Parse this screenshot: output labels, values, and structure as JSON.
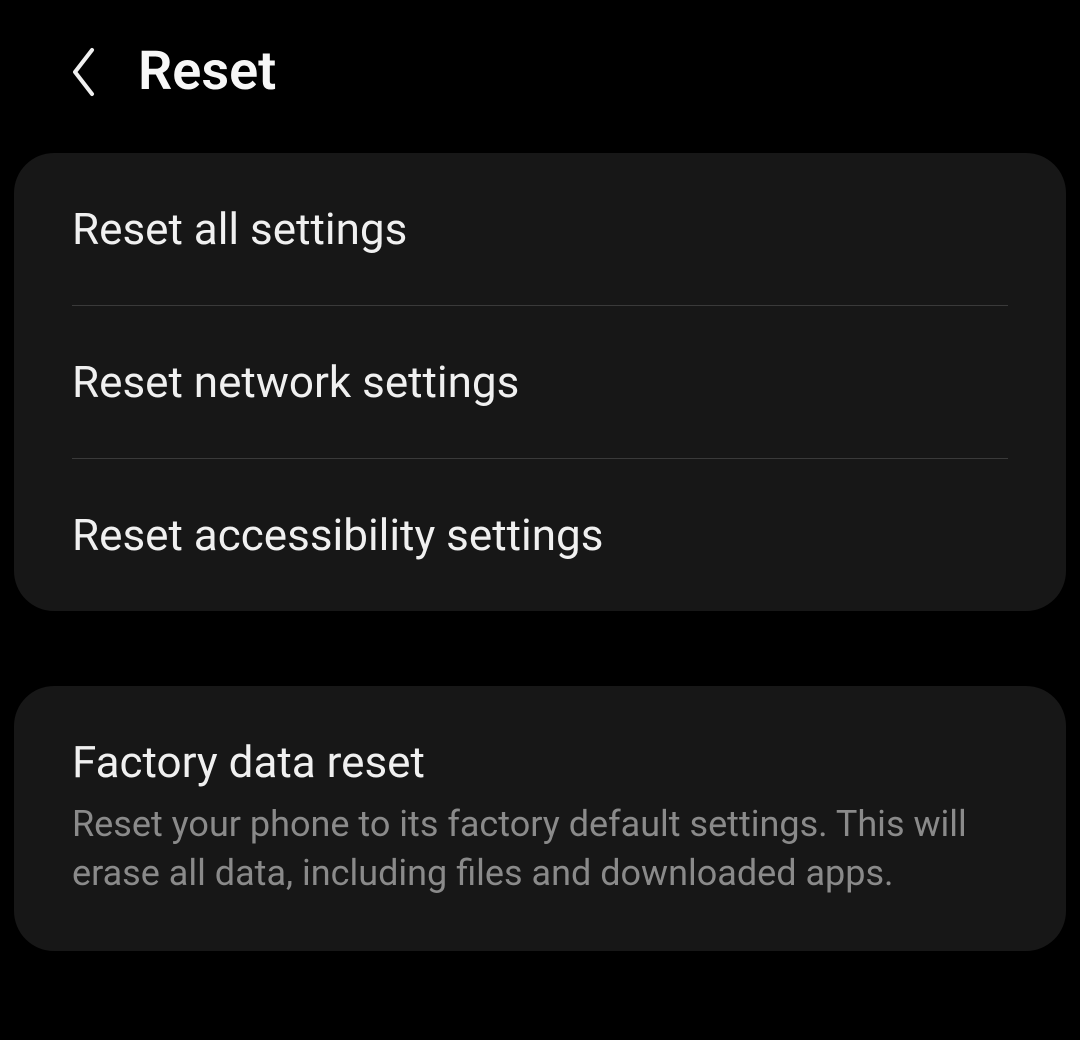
{
  "header": {
    "title": "Reset"
  },
  "section1": {
    "items": [
      {
        "title": "Reset all settings"
      },
      {
        "title": "Reset network settings"
      },
      {
        "title": "Reset accessibility settings"
      }
    ]
  },
  "section2": {
    "item": {
      "title": "Factory data reset",
      "description": "Reset your phone to its factory default settings. This will erase all data, including files and downloaded apps."
    }
  }
}
